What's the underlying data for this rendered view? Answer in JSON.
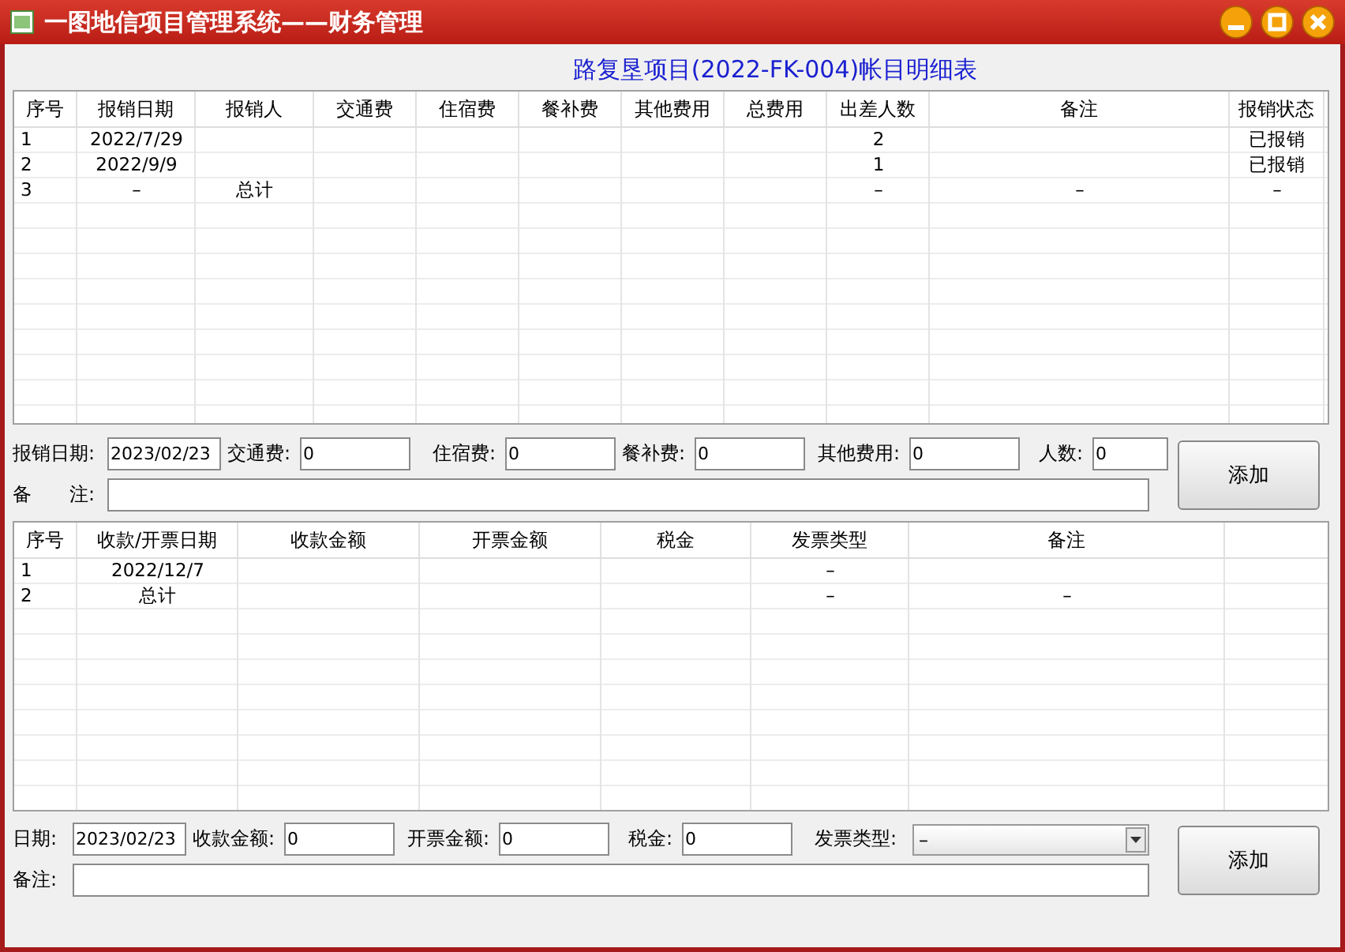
{
  "window": {
    "title": "一图地信项目管理系统——财务管理"
  },
  "heading": "路复垦项目(2022-FK-004)帐目明细表",
  "expense_table": {
    "columns": [
      "序号",
      "报销日期",
      "报销人",
      "交通费",
      "住宿费",
      "餐补费",
      "其他费用",
      "总费用",
      "出差人数",
      "备注",
      "报销状态"
    ],
    "rows": [
      [
        "1",
        "2022/7/29",
        null,
        null,
        null,
        null,
        null,
        null,
        "2",
        null,
        "已报销"
      ],
      [
        "2",
        "2022/9/9",
        null,
        null,
        null,
        null,
        null,
        null,
        "1",
        null,
        "已报销"
      ],
      [
        "3",
        "–",
        "总计",
        null,
        null,
        null,
        null,
        null,
        "–",
        "–",
        "–"
      ]
    ]
  },
  "expense_form": {
    "fields": [
      {
        "label": "报销日期:",
        "value": "2023/02/23"
      },
      {
        "label": "交通费:",
        "value": "0"
      },
      {
        "label": "住宿费:",
        "value": "0"
      },
      {
        "label": "餐补费:",
        "value": "0"
      },
      {
        "label": "其他费用:",
        "value": "0"
      },
      {
        "label": "人数:",
        "value": "0"
      }
    ],
    "remark_label": "备　　注:",
    "button": "添加"
  },
  "invoice_table": {
    "columns": [
      "序号",
      "收款/开票日期",
      "收款金额",
      "开票金额",
      "税金",
      "发票类型",
      "备注"
    ],
    "rows": [
      [
        "1",
        "2022/12/7",
        null,
        null,
        null,
        "–",
        null
      ],
      [
        "2",
        "总计",
        null,
        null,
        null,
        "–",
        "–"
      ]
    ]
  },
  "invoice_form": {
    "fields": [
      {
        "label": "日期:",
        "value": "2023/02/23"
      },
      {
        "label": "收款金额:",
        "value": "0"
      },
      {
        "label": "开票金额:",
        "value": "0"
      },
      {
        "label": "税金:",
        "value": "0"
      }
    ],
    "invoice_type": {
      "label": "发票类型:",
      "value": "–"
    },
    "remark_label": "备注:",
    "button": "添加"
  }
}
